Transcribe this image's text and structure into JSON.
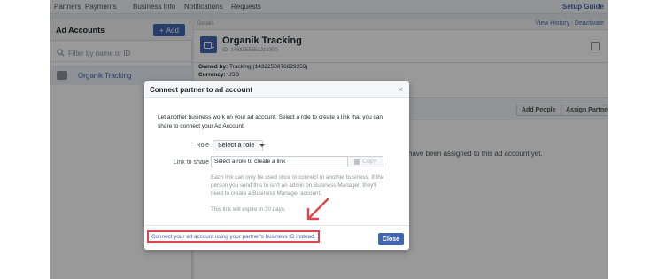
{
  "topnav": {
    "items": [
      "Partners",
      "Payments",
      "Business Info",
      "Notifications",
      "Requests"
    ],
    "setup_guide": "Setup Guide"
  },
  "left_panel": {
    "title": "Ad Accounts",
    "add_label": "Add",
    "search_placeholder": "Filter by name or ID",
    "accounts": [
      {
        "name": "Organik Tracking"
      }
    ]
  },
  "details": {
    "label": "Details",
    "view_history": "View History",
    "deactivate": "Deactivate",
    "account_name": "Organik Tracking",
    "account_id": "ID: 1488355551219300",
    "owned_by_label": "Owned by:",
    "owned_by_value": "Tracking (1432250876829359)",
    "currency_label": "Currency:",
    "currency_value": "USD",
    "add_people": "Add People",
    "assign_partner": "Assign Partner",
    "empty_message": "have been assigned to this ad account yet."
  },
  "modal": {
    "title": "Connect partner to ad account",
    "close_x": "×",
    "description": "Let another business work on your ad account. Select a role to create a link that you can share to connect your Ad Account.",
    "role_label": "Role",
    "role_select": "Select a role",
    "share_label": "Link to share",
    "share_value": "Select a role to create a link",
    "copy_label": "Copy",
    "help_text": "Each link can only be used once to connect to another business. If the person you send this to isn't an admin on Business Manager, they'll need to create a Business Manager account.",
    "expire_text": "This link will expire in 30 days.",
    "footer_link": "Connect your ad account using your partner's business ID instead.",
    "close_button": "Close"
  },
  "colors": {
    "brand_blue": "#4267b2",
    "highlight_red": "#e0454b"
  }
}
